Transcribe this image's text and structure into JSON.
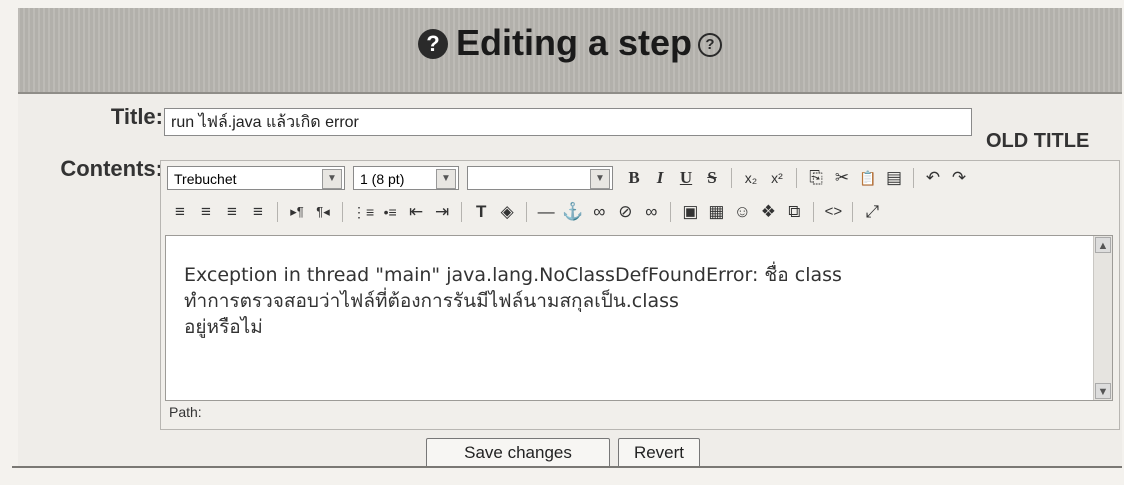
{
  "header": {
    "title": "Editing a step",
    "left_icon": "help-filled-icon",
    "right_icon": "help-outline-icon"
  },
  "form": {
    "title_label": "Title:",
    "title_value": "run ไฟล์.java แล้วเกิด error",
    "old_title_label": "OLD TITLE",
    "contents_label": "Contents:"
  },
  "toolbar": {
    "font_family": "Trebuchet",
    "font_size": "1 (8 pt)",
    "format": "",
    "row1_buttons": [
      {
        "name": "bold-icon",
        "glyph": "B"
      },
      {
        "name": "italic-icon",
        "glyph": "I"
      },
      {
        "name": "underline-icon",
        "glyph": "U"
      },
      {
        "name": "strikethrough-icon",
        "glyph": "S"
      },
      {
        "name": "subscript-icon",
        "glyph": "x₂"
      },
      {
        "name": "superscript-icon",
        "glyph": "x²"
      },
      {
        "name": "copy-icon",
        "glyph": "⎘"
      },
      {
        "name": "cut-icon",
        "glyph": "✂"
      },
      {
        "name": "paste-icon",
        "glyph": "📋"
      },
      {
        "name": "paste-word-icon",
        "glyph": "▤"
      },
      {
        "name": "undo-icon",
        "glyph": "↶"
      },
      {
        "name": "redo-icon",
        "glyph": "↷"
      }
    ],
    "row2_buttons": [
      {
        "name": "align-left-icon",
        "glyph": "≡"
      },
      {
        "name": "align-center-icon",
        "glyph": "≡"
      },
      {
        "name": "align-right-icon",
        "glyph": "≡"
      },
      {
        "name": "justify-icon",
        "glyph": "≡"
      },
      {
        "name": "ltr-icon",
        "glyph": "▸¶"
      },
      {
        "name": "rtl-icon",
        "glyph": "¶◂"
      },
      {
        "name": "ordered-list-icon",
        "glyph": "⋮≡"
      },
      {
        "name": "unordered-list-icon",
        "glyph": "•≡"
      },
      {
        "name": "outdent-icon",
        "glyph": "⇤"
      },
      {
        "name": "indent-icon",
        "glyph": "⇥"
      },
      {
        "name": "text-color-icon",
        "glyph": "T"
      },
      {
        "name": "background-color-icon",
        "glyph": "◈"
      },
      {
        "name": "horizontal-rule-icon",
        "glyph": "—"
      },
      {
        "name": "anchor-icon",
        "glyph": "⚓"
      },
      {
        "name": "link-icon",
        "glyph": "∞"
      },
      {
        "name": "unlink-icon",
        "glyph": "⊘"
      },
      {
        "name": "nolink-icon",
        "glyph": "∞"
      },
      {
        "name": "image-icon",
        "glyph": "▣"
      },
      {
        "name": "table-icon",
        "glyph": "▦"
      },
      {
        "name": "smiley-icon",
        "glyph": "☺"
      },
      {
        "name": "special-char-icon",
        "glyph": "❖"
      },
      {
        "name": "search-replace-icon",
        "glyph": "⧉"
      },
      {
        "name": "html-source-icon",
        "glyph": "<>"
      },
      {
        "name": "fullscreen-icon",
        "glyph": "⤢"
      }
    ]
  },
  "content": {
    "line1": "Exception in thread \"main\" java.lang.NoClassDefFoundError: ชื่อ class",
    "line2": "ทำการตรวจสอบว่าไฟล์ที่ต้องการรันมีไฟล์นามสกุลเป็น.class",
    "line3": "อยู่หรือไม่"
  },
  "path_label": "Path:",
  "actions": {
    "save": "Save changes",
    "revert": "Revert"
  }
}
